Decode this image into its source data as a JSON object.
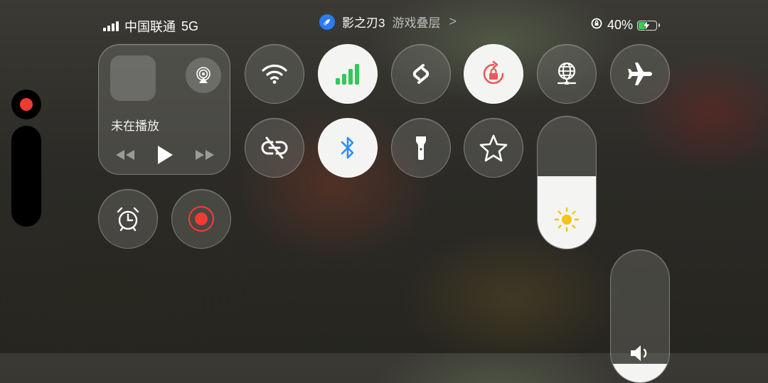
{
  "status": {
    "carrier": "中国联通",
    "network": "5G",
    "signal_bars": 4,
    "battery_percent": "40%",
    "battery_level": 0.4,
    "overlay_app_name": "影之刃3",
    "overlay_label": "游戏叠层",
    "chevron": ">"
  },
  "media": {
    "now_playing": "未在播放"
  },
  "brightness": {
    "level": 0.55
  },
  "volume": {
    "level": 0.14
  },
  "colors": {
    "signal_green": "#34c759",
    "bluetooth_blue": "#2f8df5",
    "lock_red": "#e85a5a",
    "record_red": "#ef3b34",
    "sun_yellow": "#f6c21b"
  }
}
